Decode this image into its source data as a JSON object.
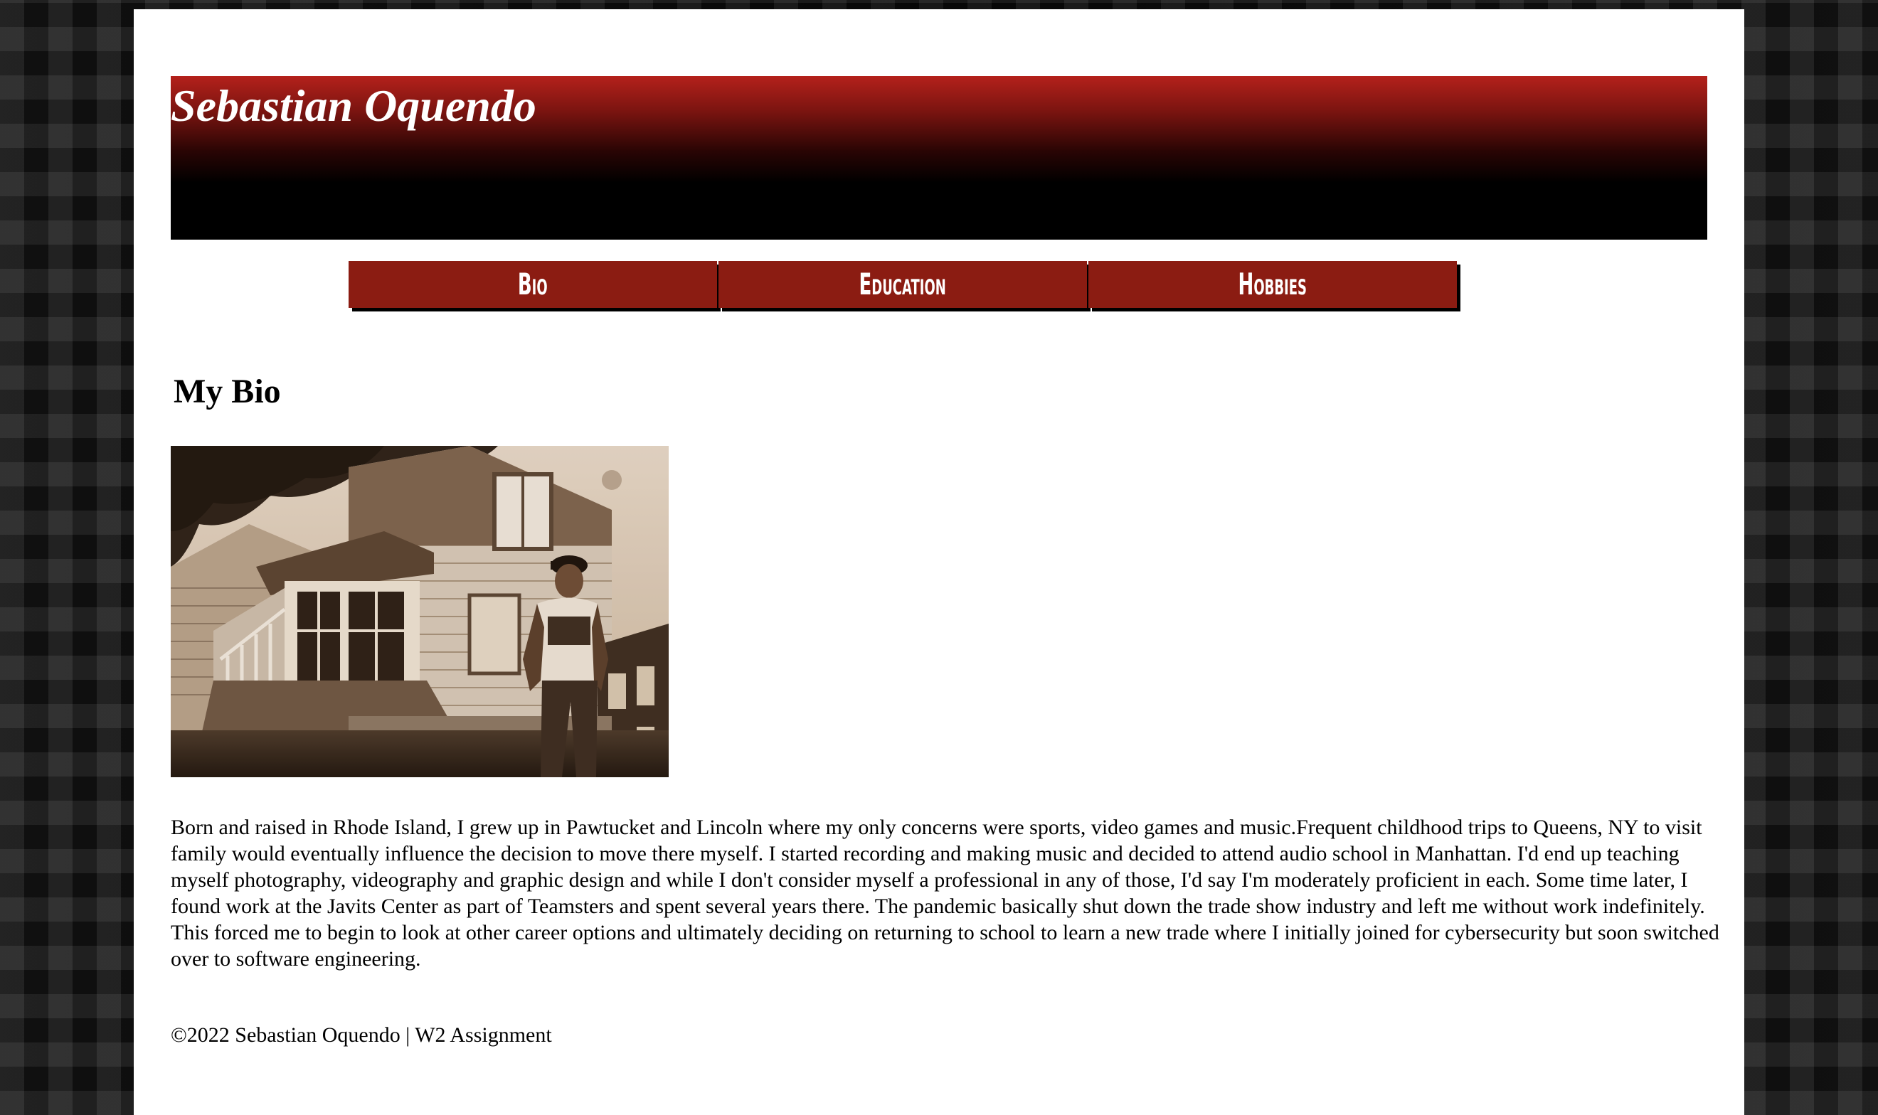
{
  "site": {
    "title": "Sebastian Oquendo"
  },
  "nav": {
    "items": [
      {
        "label": "Bio"
      },
      {
        "label": "Education"
      },
      {
        "label": "Hobbies"
      }
    ]
  },
  "main": {
    "heading": "My Bio",
    "photo_icon": "portrait-photo",
    "bio": "Born and raised in Rhode Island, I grew up in Pawtucket and Lincoln where my only concerns were sports, video games and music.Frequent childhood trips to Queens, NY to visit family would eventually influence the decision to move there myself. I started recording and making music and decided to attend audio school in Manhattan. I'd end up teaching myself photography, videography and graphic design and while I don't consider myself a professional in any of those, I'd say I'm moderately proficient in each. Some time later, I found work at the Javits Center as part of Teamsters and spent several years there. The pandemic basically shut down the trade show industry and left me without work indefinitely. This forced me to begin to look at other career options and ultimately deciding on returning to school to learn a new trade where I initially joined for cybersecurity but soon switched over to software engineering."
  },
  "footer": {
    "text": "©2022 Sebastian Oquendo | W2 Assignment"
  },
  "colors": {
    "banner_top": "#b4211b",
    "banner_bottom": "#000000",
    "nav_bg": "#8b1c12",
    "page_bg": "#ffffff"
  }
}
